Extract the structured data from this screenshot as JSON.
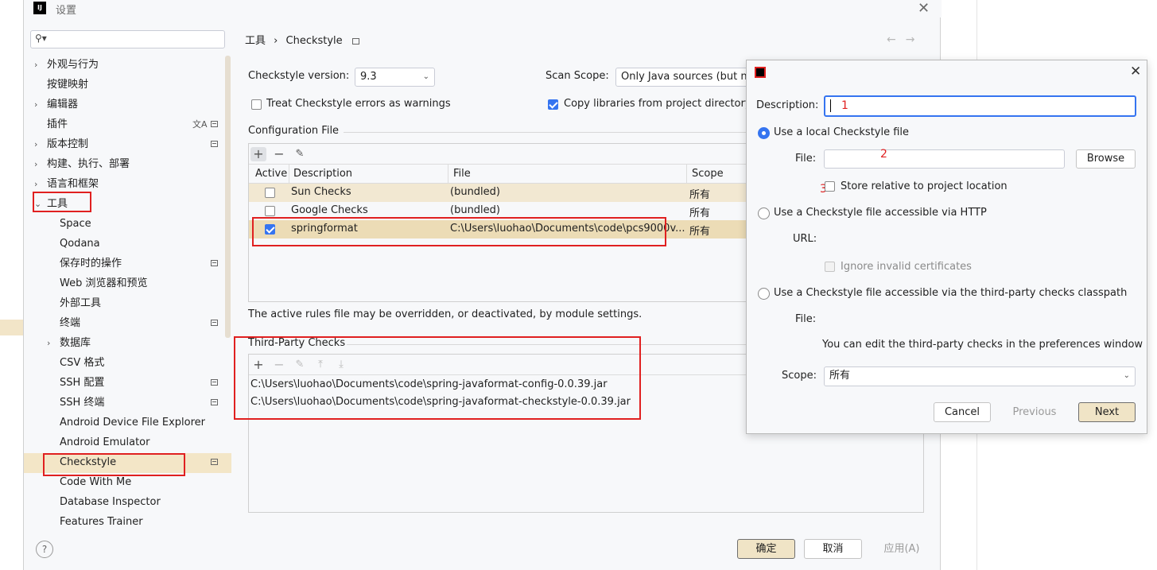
{
  "window": {
    "title": "设置",
    "app_icon": "IJ"
  },
  "search": {
    "placeholder": ""
  },
  "tree": {
    "items": [
      {
        "label": "外观与行为",
        "chevron": "›"
      },
      {
        "label": "按键映射"
      },
      {
        "label": "编辑器",
        "chevron": "›"
      },
      {
        "label": "插件"
      },
      {
        "label": "版本控制",
        "chevron": "›"
      },
      {
        "label": "构建、执行、部署",
        "chevron": "›"
      },
      {
        "label": "语言和框架",
        "chevron": "›"
      },
      {
        "label": "工具",
        "chevron": "⌄"
      },
      {
        "label": "Space"
      },
      {
        "label": "Qodana"
      },
      {
        "label": "保存时的操作"
      },
      {
        "label": "Web 浏览器和预览"
      },
      {
        "label": "外部工具"
      },
      {
        "label": "终端"
      },
      {
        "label": "数据库",
        "chevron": "›"
      },
      {
        "label": "CSV 格式"
      },
      {
        "label": "SSH 配置"
      },
      {
        "label": "SSH 终端"
      },
      {
        "label": "Android Device File Explorer"
      },
      {
        "label": "Android Emulator"
      },
      {
        "label": "Checkstyle"
      },
      {
        "label": "Code With Me"
      },
      {
        "label": "Database Inspector"
      },
      {
        "label": "Features Trainer"
      }
    ]
  },
  "breadcrumb": {
    "parent": "工具",
    "sep": "›",
    "current": "Checkstyle"
  },
  "nav": {
    "back": "←",
    "forward": "→"
  },
  "checkstyle": {
    "version_label": "Checkstyle version:",
    "version_value": "9.3",
    "scan_scope_label": "Scan Scope:",
    "scan_scope_value": "Only Java sources (but no",
    "treat_errors_label": "Treat Checkstyle errors as warnings",
    "copy_libs_label": "Copy libraries from project directory"
  },
  "config": {
    "section_title": "Configuration File",
    "columns": [
      "Active",
      "Description",
      "File",
      "Scope"
    ],
    "rows": [
      {
        "active": false,
        "description": "Sun Checks",
        "file": "(bundled)",
        "scope": "所有"
      },
      {
        "active": false,
        "description": "Google Checks",
        "file": "(bundled)",
        "scope": "所有"
      },
      {
        "active": true,
        "description": "springformat",
        "file": "C:\\Users\\luohao\\Documents\\code\\pcs9000v...",
        "scope": "所有"
      }
    ],
    "note": "The active rules file may be overridden, or deactivated, by module settings."
  },
  "third_party": {
    "section_title": "Third-Party Checks",
    "paths": [
      "C:\\Users\\luohao\\Documents\\code\\spring-javaformat-config-0.0.39.jar",
      "C:\\Users\\luohao\\Documents\\code\\spring-javaformat-checkstyle-0.0.39.jar"
    ]
  },
  "footer": {
    "ok": "确定",
    "cancel": "取消",
    "apply": "应用(A)",
    "help": "?"
  },
  "dialog": {
    "description_label": "Description:",
    "description_value": "",
    "opt_local": "Use a local Checkstyle file",
    "file_label": "File:",
    "browse": "Browse",
    "store_relative": "Store relative to project location",
    "opt_http": "Use a Checkstyle file accessible via HTTP",
    "url_label": "URL:",
    "ignore_certs": "Ignore invalid certificates",
    "opt_classpath": "Use a Checkstyle file accessible via the third-party checks classpath",
    "file_label2": "File:",
    "classpath_note": "You can edit the third-party checks in the preferences window",
    "scope_label": "Scope:",
    "scope_value": "所有",
    "cancel": "Cancel",
    "previous": "Previous",
    "next": "Next"
  },
  "annotations": {
    "n1": "1",
    "n2": "2",
    "n3": "3"
  },
  "colors": {
    "accent": "#3574f0",
    "annotation_red": "#e02020",
    "selection": "#f3e6c7"
  }
}
